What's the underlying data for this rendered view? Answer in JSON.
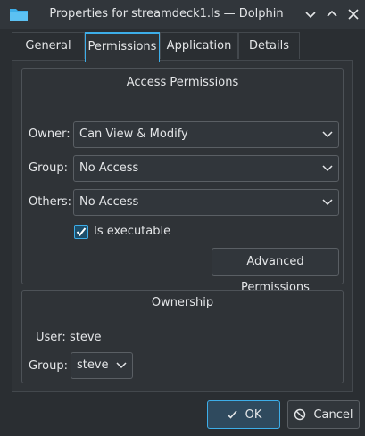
{
  "window": {
    "title": "Properties for streamdeck1.ls — Dolphin"
  },
  "tabs": [
    {
      "label": "General"
    },
    {
      "label": "Permissions"
    },
    {
      "label": "Application"
    },
    {
      "label": "Details"
    }
  ],
  "active_tab": "Permissions",
  "access": {
    "title": "Access Permissions",
    "owner_label": "Owner:",
    "owner_value": "Can View & Modify",
    "group_label": "Group:",
    "group_value": "No Access",
    "others_label": "Others:",
    "others_value": "No Access",
    "executable_label": "Is executable",
    "executable_checked": true,
    "advanced_button": "Advanced Permissions"
  },
  "ownership": {
    "title": "Ownership",
    "user_label": "User:",
    "user_value": "steve",
    "group_label": "Group:",
    "group_value": "steve"
  },
  "footer": {
    "ok_label": "OK",
    "cancel_label": "Cancel"
  },
  "colors": {
    "accent": "#3daee9",
    "background": "#2a2e32",
    "text": "#e4e6e8"
  },
  "icons": [
    "folder-icon",
    "chevron-down-icon",
    "chevron-up-icon",
    "close-icon",
    "checkmark-icon",
    "cancel-icon"
  ]
}
